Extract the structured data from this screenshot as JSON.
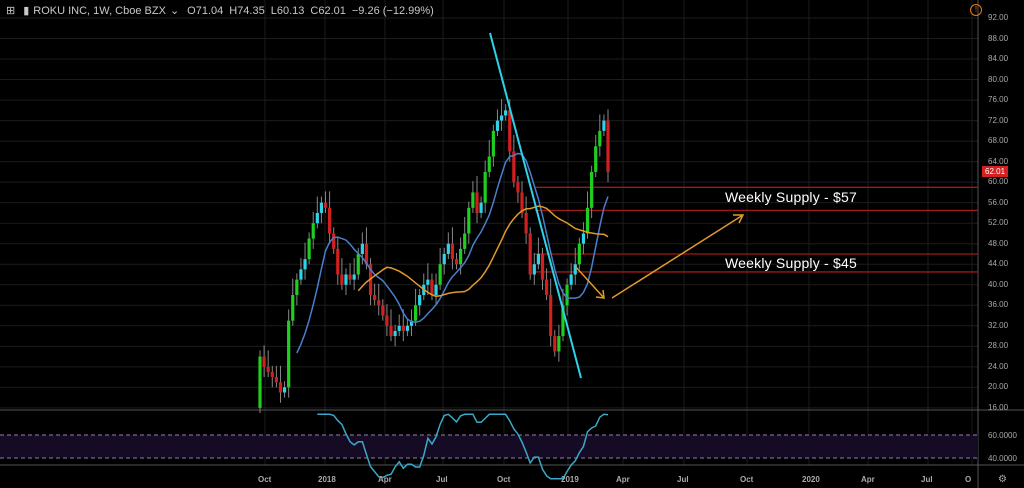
{
  "header": {
    "symbol": "ROKU INC, 1W, Cboe BZX",
    "open": "O71.04",
    "high": "H74.35",
    "low": "L60.13",
    "close": "C62.01",
    "change": "−9.26 (−12.99%)"
  },
  "annotations": {
    "supply_57": "Weekly Supply - $57",
    "supply_45": "Weekly Supply - $45"
  },
  "colors": {
    "up": "#1fcf1f",
    "down": "#d21f1f",
    "small": "#2ed3e8",
    "ma_fast": "#4a7fd0",
    "ma_slow": "#e09a2a",
    "trendline": "#2ed3e8",
    "supply": "#a01818",
    "rsi": "#3aa8c8",
    "arrow": "#e09a2a"
  },
  "chart_data": {
    "type": "candlestick",
    "title": "ROKU INC, 1W, Cboe BZX",
    "ylim": [
      14,
      94
    ],
    "y_ticks": [
      "92.00",
      "88.00",
      "84.00",
      "80.00",
      "76.00",
      "72.00",
      "68.00",
      "64.00",
      "60.00",
      "56.00",
      "52.00",
      "48.00",
      "44.00",
      "40.00",
      "36.00",
      "32.00",
      "28.00",
      "24.00",
      "20.00",
      "16.00"
    ],
    "x_ticks": [
      "Oct",
      "2018",
      "Apr",
      "Jul",
      "Oct",
      "2019",
      "Apr",
      "Jul",
      "Oct",
      "2020",
      "Apr",
      "Jul",
      "O"
    ],
    "last_price": "62.01",
    "closes": [
      26,
      24,
      23,
      22,
      21,
      19,
      20,
      33,
      38,
      41,
      43,
      45,
      49,
      52,
      54,
      56,
      55,
      50,
      47,
      42,
      40,
      42,
      41,
      42,
      46,
      48,
      44,
      38,
      37,
      36,
      34,
      32,
      30,
      31,
      32,
      31,
      32,
      33,
      36,
      38,
      40,
      41,
      38,
      40,
      44,
      46,
      48,
      45,
      44,
      47,
      50,
      55,
      58,
      54,
      56,
      62,
      65,
      70,
      72,
      73,
      74,
      66,
      60,
      58,
      54,
      50,
      42,
      44,
      46,
      41,
      38,
      30,
      27,
      30,
      36,
      40,
      42,
      44,
      48,
      50,
      55,
      62,
      67,
      70,
      72,
      62.01
    ],
    "supply_levels": [
      59,
      54.5,
      46,
      42.5
    ],
    "rsi": {
      "levels": [
        "60.0000",
        "40.0000"
      ],
      "ylim": [
        20,
        80
      ]
    }
  }
}
